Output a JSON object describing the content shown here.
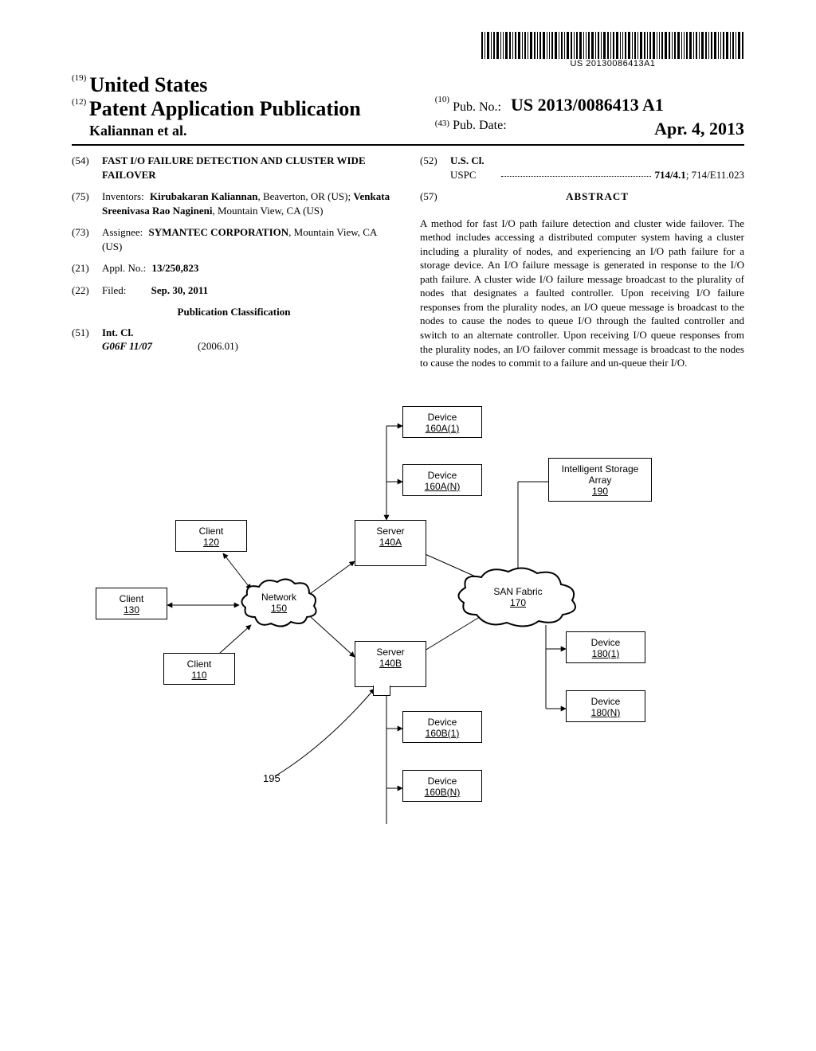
{
  "barcode_text": "US 20130086413A1",
  "header": {
    "country_code": "(19)",
    "country": "United States",
    "pub_type_code": "(12)",
    "pub_type": "Patent Application Publication",
    "inventor_short": "Kaliannan et al.",
    "pubno_code": "(10)",
    "pubno_label": "Pub. No.:",
    "pubno": "US 2013/0086413 A1",
    "pubdate_code": "(43)",
    "pubdate_label": "Pub. Date:",
    "pubdate": "Apr. 4, 2013"
  },
  "biblio": {
    "title_code": "(54)",
    "title": "FAST I/O FAILURE DETECTION AND CLUSTER WIDE FAILOVER",
    "inventors_code": "(75)",
    "inventors_label": "Inventors:",
    "inventors": "Kirubakaran Kaliannan, Beaverton, OR (US); Venkata Sreenivasa Rao Nagineni, Mountain View, CA (US)",
    "assignee_code": "(73)",
    "assignee_label": "Assignee:",
    "assignee": "SYMANTEC CORPORATION, Mountain View, CA (US)",
    "appl_code": "(21)",
    "appl_label": "Appl. No.:",
    "appl_no": "13/250,823",
    "filed_code": "(22)",
    "filed_label": "Filed:",
    "filed": "Sep. 30, 2011",
    "pubclass_header": "Publication Classification",
    "intcl_code": "(51)",
    "intcl_label": "Int. Cl.",
    "intcl_class": "G06F 11/07",
    "intcl_date": "(2006.01)",
    "uscl_code": "(52)",
    "uscl_label": "U.S. Cl.",
    "uspc_label": "USPC",
    "uspc_vals": "714/4.1; 714/E11.023",
    "uspc_bold": "714/4.1",
    "uspc_rest": "; 714/E11.023",
    "abstract_code": "(57)",
    "abstract_label": "ABSTRACT",
    "abstract_text": "A method for fast I/O path failure detection and cluster wide failover. The method includes accessing a distributed computer system having a cluster including a plurality of nodes, and experiencing an I/O path failure for a storage device. An I/O failure message is generated in response to the I/O path failure. A cluster wide I/O failure message broadcast to the plurality of nodes that designates a faulted controller. Upon receiving I/O failure responses from the plurality nodes, an I/O queue message is broadcast to the nodes to cause the nodes to queue I/O through the faulted controller and switch to an alternate controller. Upon receiving I/O queue responses from the plurality nodes, an I/O failover commit message is broadcast to the nodes to cause the nodes to commit to a failure and un-queue their I/O."
  },
  "figure": {
    "device160a1": {
      "label": "Device",
      "ref": "160A(1)"
    },
    "device160an": {
      "label": "Device",
      "ref": "160A(N)"
    },
    "storage_array": {
      "label1": "Intelligent Storage",
      "label2": "Array",
      "ref": "190"
    },
    "client120": {
      "label": "Client",
      "ref": "120"
    },
    "client130": {
      "label": "Client",
      "ref": "130"
    },
    "client110": {
      "label": "Client",
      "ref": "110"
    },
    "server140a": {
      "label": "Server",
      "ref": "140A"
    },
    "server140b": {
      "label": "Server",
      "ref": "140B"
    },
    "network": {
      "label": "Network",
      "ref": "150"
    },
    "san": {
      "label": "SAN Fabric",
      "ref": "170"
    },
    "device1801": {
      "label": "Device",
      "ref": "180(1)"
    },
    "device180n": {
      "label": "Device",
      "ref": "180(N)"
    },
    "device160b1": {
      "label": "Device",
      "ref": "160B(1)"
    },
    "device160bn": {
      "label": "Device",
      "ref": "160B(N)"
    },
    "annot195": "195"
  }
}
